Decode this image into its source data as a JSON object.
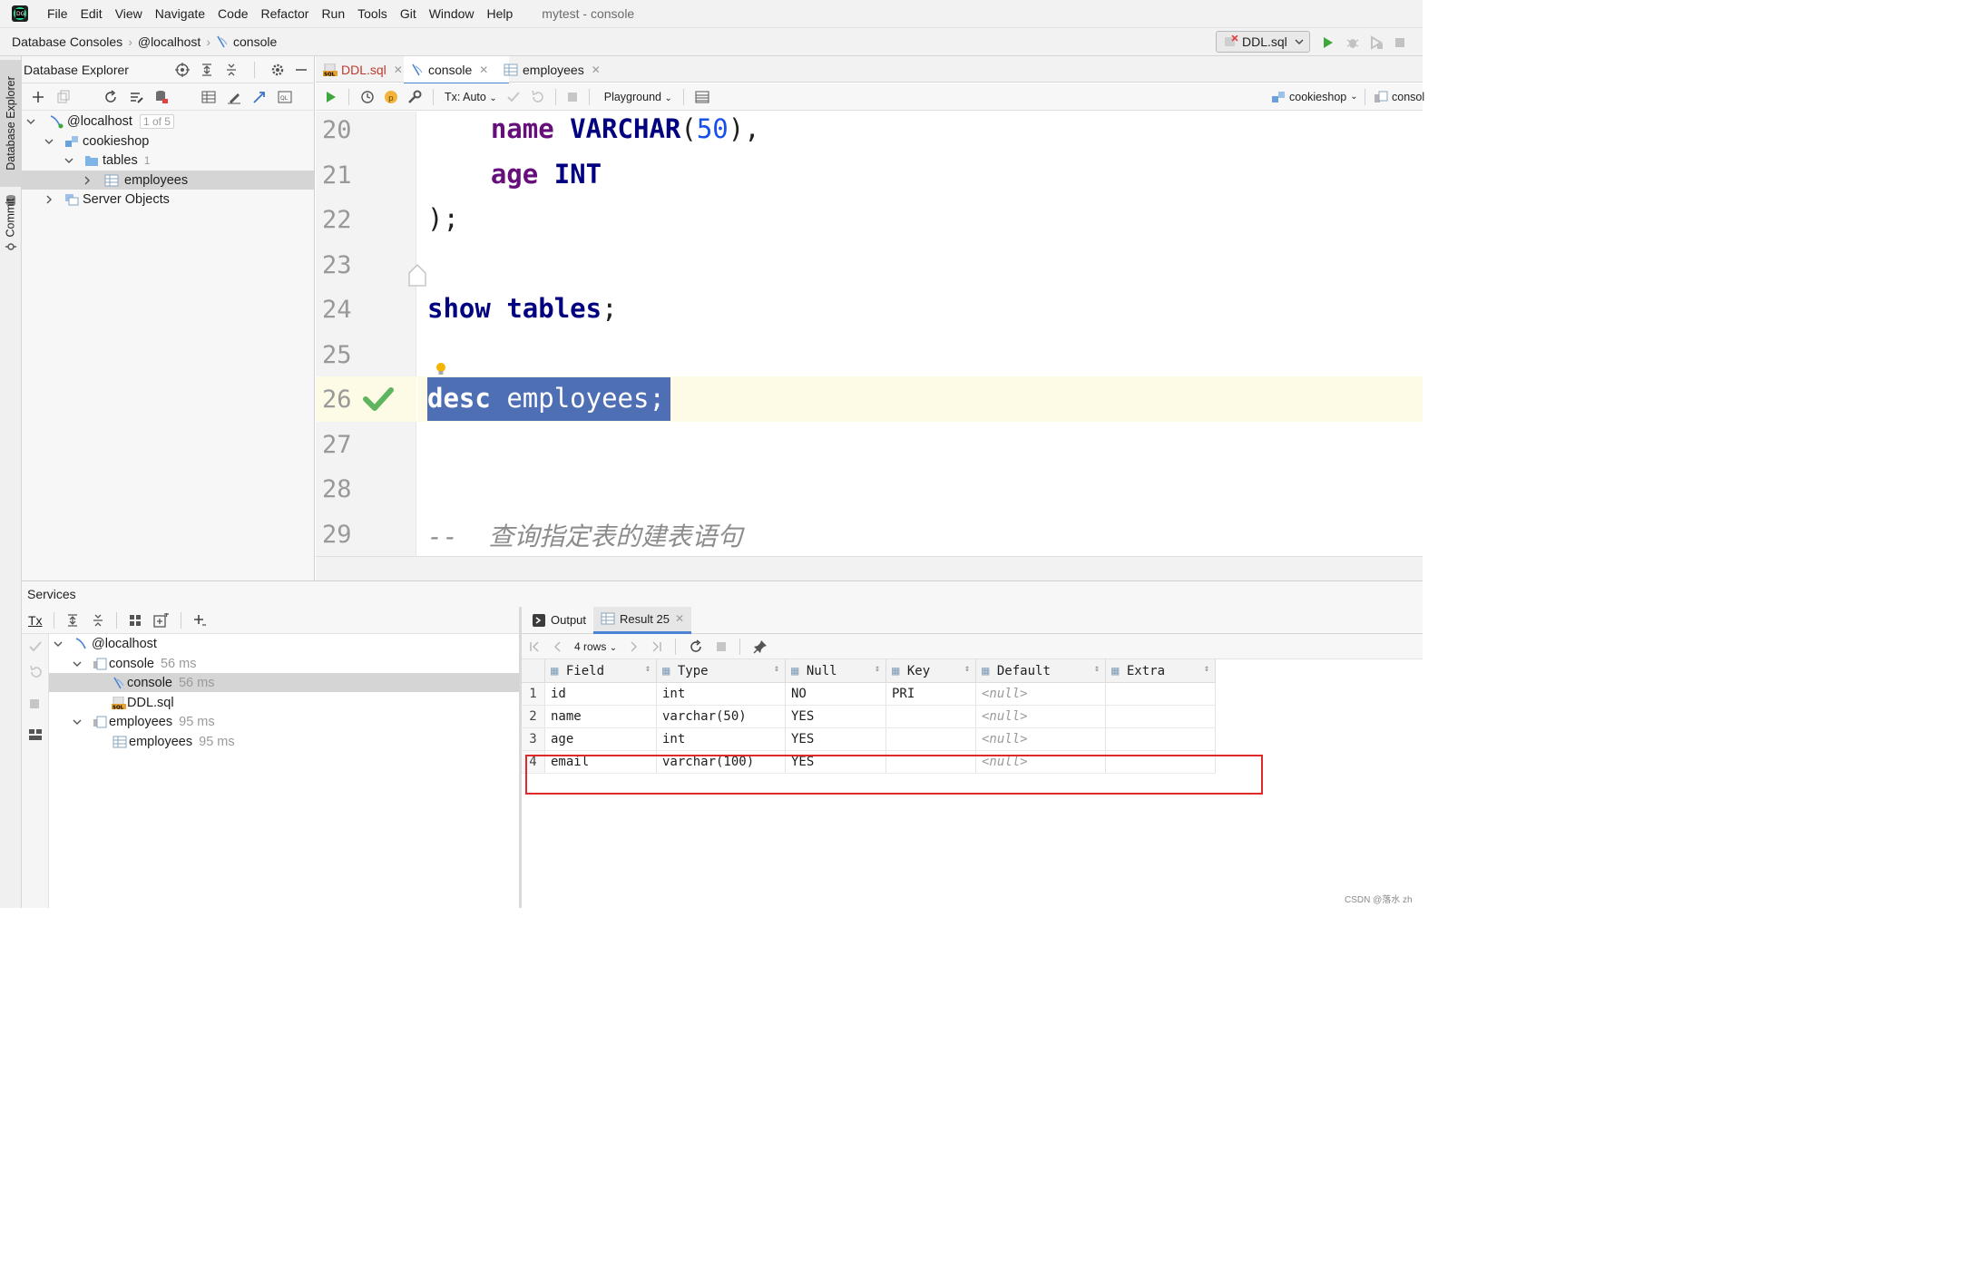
{
  "menubar": {
    "items": [
      "File",
      "Edit",
      "View",
      "Navigate",
      "Code",
      "Refactor",
      "Run",
      "Tools",
      "Git",
      "Window",
      "Help"
    ],
    "window_title": "mytest - console"
  },
  "navbar": {
    "breadcrumbs": [
      "Database Consoles",
      "@localhost",
      "console"
    ],
    "run_config": "DDL.sql"
  },
  "left_stripe": {
    "tabs": [
      "Database Explorer",
      "Commit"
    ]
  },
  "db_explorer": {
    "title": "Database Explorer",
    "tree": [
      {
        "label": "@localhost",
        "badge": "1 of 5"
      },
      {
        "label": "cookieshop",
        "badge": ""
      },
      {
        "label": "tables",
        "badge": "1"
      },
      {
        "label": "employees",
        "badge": ""
      },
      {
        "label": "Server Objects",
        "badge": ""
      }
    ]
  },
  "editor": {
    "tabs": [
      "DDL.sql",
      "console",
      "employees"
    ],
    "toolbar": {
      "tx": "Tx: Auto",
      "playground": "Playground",
      "schema": "cookieshop",
      "console": "consol"
    },
    "lines": [
      {
        "n": "20"
      },
      {
        "n": "21"
      },
      {
        "n": "22"
      },
      {
        "n": "23"
      },
      {
        "n": "24"
      },
      {
        "n": "25"
      },
      {
        "n": "26"
      },
      {
        "n": "27"
      },
      {
        "n": "28"
      },
      {
        "n": "29"
      }
    ],
    "code": {
      "l20_a": "name",
      "l20_b": "VARCHAR",
      "l20_c": "(",
      "l20_d": "50",
      "l20_e": "),",
      "l21_a": "age",
      "l21_b": "INT",
      "l22": ");",
      "l24_a": "show",
      "l24_b": "tables",
      "l24_c": ";",
      "l26_a": "desc",
      "l26_b": "employees",
      "l26_c": ";",
      "l29": "--  查询指定表的建表语句"
    }
  },
  "services": {
    "title": "Services",
    "tx_label": "Tx",
    "tree": [
      {
        "label": "@localhost",
        "time": ""
      },
      {
        "label": "console",
        "time": "56 ms"
      },
      {
        "label": "console",
        "time": "56 ms"
      },
      {
        "label": "DDL.sql",
        "time": ""
      },
      {
        "label": "employees",
        "time": "95 ms"
      },
      {
        "label": "employees",
        "time": "95 ms"
      }
    ]
  },
  "results": {
    "tabs": [
      "Output",
      "Result 25"
    ],
    "rows_label": "4 rows",
    "columns": [
      "Field",
      "Type",
      "Null",
      "Key",
      "Default",
      "Extra"
    ],
    "rows": [
      [
        "1",
        "id",
        "int",
        "NO",
        "PRI",
        "<null>",
        ""
      ],
      [
        "2",
        "name",
        "varchar(50)",
        "YES",
        "",
        "<null>",
        ""
      ],
      [
        "3",
        "age",
        "int",
        "YES",
        "",
        "<null>",
        ""
      ],
      [
        "4",
        "email",
        "varchar(100)",
        "YES",
        "",
        "<null>",
        ""
      ]
    ]
  },
  "watermark": "CSDN @落水 zh",
  "colors": {
    "selection": "#4f6fb5",
    "current_line": "#fdfbe6",
    "highlight_box": "#e02a2a",
    "run_green": "#3ea83e"
  }
}
